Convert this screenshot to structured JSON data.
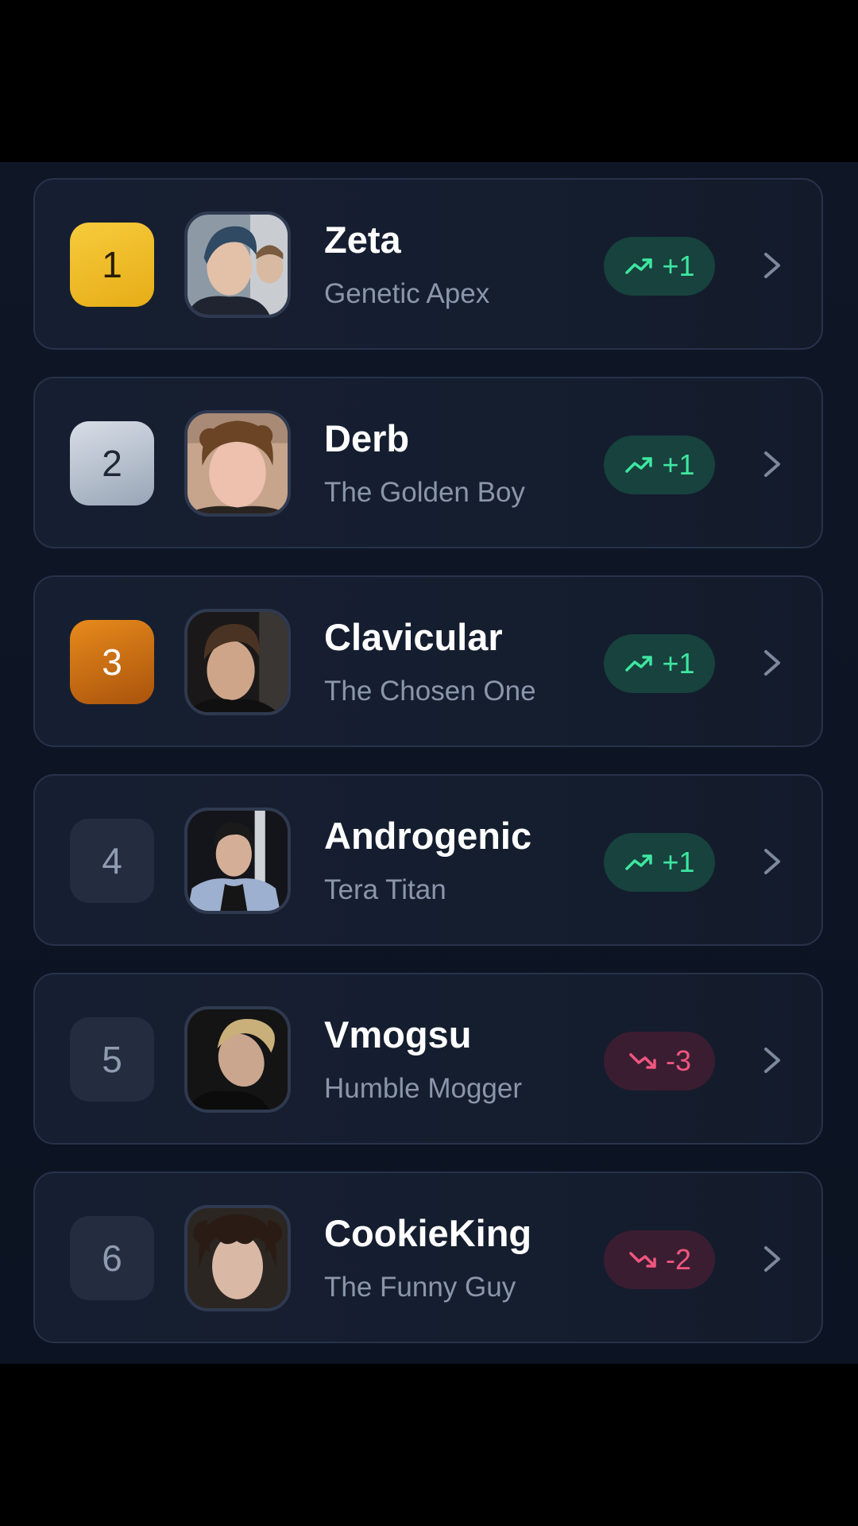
{
  "leaderboard": {
    "entries": [
      {
        "rank": "1",
        "name": "Zeta",
        "title": "Genetic Apex",
        "change": "+1",
        "direction": "up",
        "rank_style": "gold"
      },
      {
        "rank": "2",
        "name": "Derb",
        "title": "The Golden Boy",
        "change": "+1",
        "direction": "up",
        "rank_style": "silver"
      },
      {
        "rank": "3",
        "name": "Clavicular",
        "title": "The Chosen One",
        "change": "+1",
        "direction": "up",
        "rank_style": "bronze"
      },
      {
        "rank": "4",
        "name": "Androgenic",
        "title": "Tera Titan",
        "change": "+1",
        "direction": "up",
        "rank_style": "plain"
      },
      {
        "rank": "5",
        "name": "Vmogsu",
        "title": "Humble Mogger",
        "change": "-3",
        "direction": "down",
        "rank_style": "plain"
      },
      {
        "rank": "6",
        "name": "CookieKing",
        "title": "The Funny Guy",
        "change": "-2",
        "direction": "down",
        "rank_style": "plain"
      }
    ]
  },
  "icons": {
    "trend_up": "trending-up-icon",
    "trend_down": "trending-down-icon",
    "row_arrow": "chevron-right-icon"
  },
  "colors": {
    "up": "#3ee6a0",
    "down": "#f0567e",
    "gold": "#f0be2c",
    "silver": "#c1cad6",
    "bronze": "#d2741a"
  }
}
